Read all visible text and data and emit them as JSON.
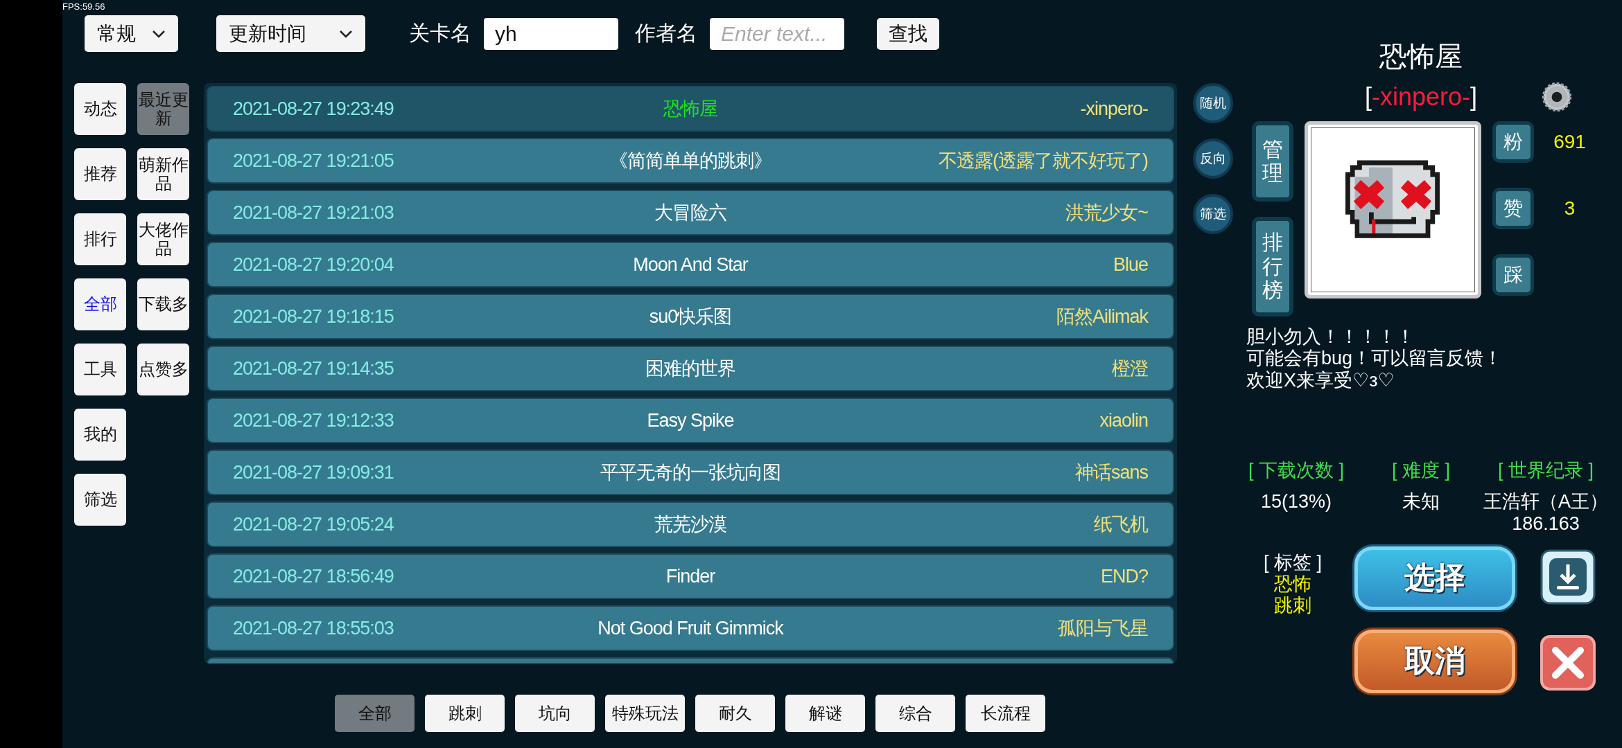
{
  "fps": "FPS:59.56",
  "filters": {
    "category": {
      "value": "常规"
    },
    "sort": {
      "value": "更新时间"
    },
    "level_name": {
      "label": "关卡名",
      "value": "yh"
    },
    "author": {
      "label": "作者名",
      "placeholder": "Enter text..."
    },
    "search_button": "查找"
  },
  "left_menu": [
    {
      "label": "动态",
      "selected": false
    },
    {
      "label": "推荐",
      "selected": false
    },
    {
      "label": "排行",
      "selected": false
    },
    {
      "label": "全部",
      "selected": true
    },
    {
      "label": "工具",
      "selected": false
    },
    {
      "label": "我的",
      "selected": false
    },
    {
      "label": "筛选",
      "selected": false
    }
  ],
  "right_menu": [
    {
      "label": "最近更新",
      "selected": true
    },
    {
      "label": "萌新作品",
      "selected": false
    },
    {
      "label": "大佬作品",
      "selected": false
    },
    {
      "label": "下载多",
      "selected": false
    },
    {
      "label": "点赞多",
      "selected": false
    }
  ],
  "levels": [
    {
      "time": "2021-08-27 19:23:49",
      "title": "恐怖屋",
      "author": "-xinpero-",
      "selected": true
    },
    {
      "time": "2021-08-27 19:21:05",
      "title": "《简简单单的跳刺》",
      "author": "不透露(透露了就不好玩了)",
      "selected": false
    },
    {
      "time": "2021-08-27 19:21:03",
      "title": "大冒险六",
      "author": "洪荒少女~",
      "selected": false
    },
    {
      "time": "2021-08-27 19:20:04",
      "title": "Moon  And  Star",
      "author": "Blue",
      "selected": false
    },
    {
      "time": "2021-08-27 19:18:15",
      "title": "su0快乐图",
      "author": "陌然Ailimak",
      "selected": false
    },
    {
      "time": "2021-08-27 19:14:35",
      "title": "困难的世界",
      "author": "橙澄",
      "selected": false
    },
    {
      "time": "2021-08-27 19:12:33",
      "title": "Easy Spike",
      "author": "xiaolin",
      "selected": false
    },
    {
      "time": "2021-08-27 19:09:31",
      "title": "平平无奇的一张坑向图",
      "author": "神话sans",
      "selected": false
    },
    {
      "time": "2021-08-27 19:05:24",
      "title": "荒芜沙漠",
      "author": "纸飞机",
      "selected": false
    },
    {
      "time": "2021-08-27 18:56:49",
      "title": "Finder",
      "author": "END?",
      "selected": false
    },
    {
      "time": "2021-08-27 18:55:03",
      "title": "Not Good Fruit Gimmick",
      "author": "孤阳与飞星",
      "selected": false
    }
  ],
  "side_buttons": [
    "随机",
    "反向",
    "筛选"
  ],
  "category_tabs": [
    {
      "label": "全部",
      "selected": true
    },
    {
      "label": "跳刺",
      "selected": false
    },
    {
      "label": "坑向",
      "selected": false
    },
    {
      "label": "特殊玩法",
      "selected": false
    },
    {
      "label": "耐久",
      "selected": false
    },
    {
      "label": "解谜",
      "selected": false
    },
    {
      "label": "综合",
      "selected": false
    },
    {
      "label": "长流程",
      "selected": false
    }
  ],
  "detail": {
    "title": "恐怖屋",
    "author": {
      "open": "[",
      "name": "-xinpero-",
      "close": "]"
    },
    "manage_buttons": [
      "管理",
      "排行榜"
    ],
    "reactions": [
      {
        "label": "粉",
        "count": "691"
      },
      {
        "label": "赞",
        "count": "3"
      },
      {
        "label": "踩"
      }
    ],
    "description": [
      "胆小勿入！！！！！",
      "可能会有bug！可以留言反馈！",
      "欢迎X来享受♡з♡"
    ],
    "stats": [
      {
        "label": "[ 下载次数 ]",
        "values": [
          "15(13%)"
        ]
      },
      {
        "label": "[ 难度 ]",
        "values": [
          "未知"
        ]
      },
      {
        "label": "[ 世界纪录 ]",
        "values": [
          "王浩轩（A王）",
          "186.163"
        ]
      }
    ],
    "tags_label": "[ 标签 ]",
    "tags": [
      "恐怖",
      "跳刺"
    ],
    "select_button": "选择",
    "cancel_button": "取消"
  }
}
